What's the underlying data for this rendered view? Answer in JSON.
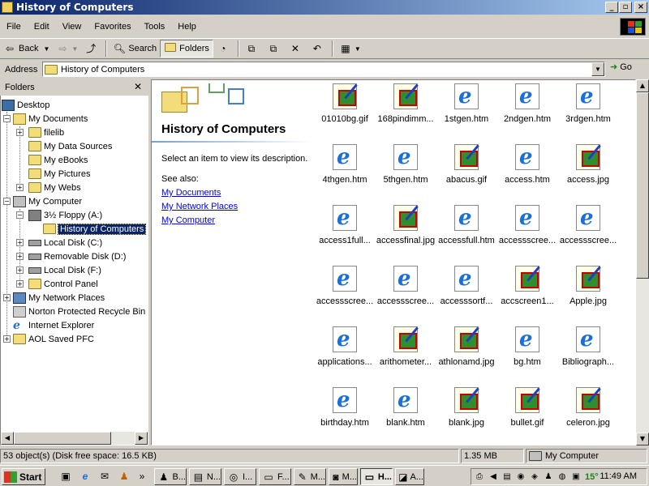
{
  "window": {
    "title": "History of Computers"
  },
  "menu": [
    "File",
    "Edit",
    "View",
    "Favorites",
    "Tools",
    "Help"
  ],
  "toolbar": {
    "back": "Back",
    "search": "Search",
    "folders": "Folders"
  },
  "address": {
    "label": "Address",
    "value": "History of Computers",
    "go": "Go"
  },
  "folders_pane": {
    "title": "Folders",
    "items": [
      {
        "label": "Desktop"
      },
      {
        "label": "My Documents"
      },
      {
        "label": "filelib"
      },
      {
        "label": "My Data Sources"
      },
      {
        "label": "My eBooks"
      },
      {
        "label": "My Pictures"
      },
      {
        "label": "My Webs"
      },
      {
        "label": "My Computer"
      },
      {
        "label": "3½ Floppy (A:)"
      },
      {
        "label": "History of Computers"
      },
      {
        "label": "Local Disk (C:)"
      },
      {
        "label": "Removable Disk (D:)"
      },
      {
        "label": "Local Disk (F:)"
      },
      {
        "label": "Control Panel"
      },
      {
        "label": "My Network Places"
      },
      {
        "label": "Norton Protected Recycle Bin"
      },
      {
        "label": "Internet Explorer"
      },
      {
        "label": "AOL Saved PFC"
      }
    ]
  },
  "info_panel": {
    "title": "History of Computers",
    "prompt": "Select an item to view its description.",
    "see_also": "See also:",
    "links": [
      "My Documents",
      "My Network Places",
      "My Computer"
    ]
  },
  "files": [
    {
      "name": "01010bg.gif",
      "type": "image"
    },
    {
      "name": "168pindimm...",
      "type": "image"
    },
    {
      "name": "1stgen.htm",
      "type": "html"
    },
    {
      "name": "2ndgen.htm",
      "type": "html"
    },
    {
      "name": "3rdgen.htm",
      "type": "html"
    },
    {
      "name": "4thgen.htm",
      "type": "html"
    },
    {
      "name": "5thgen.htm",
      "type": "html"
    },
    {
      "name": "abacus.gif",
      "type": "image"
    },
    {
      "name": "access.htm",
      "type": "html"
    },
    {
      "name": "access.jpg",
      "type": "image"
    },
    {
      "name": "access1full...",
      "type": "html"
    },
    {
      "name": "accessfinal.jpg",
      "type": "image"
    },
    {
      "name": "accessfull.htm",
      "type": "html"
    },
    {
      "name": "accessscree...",
      "type": "html"
    },
    {
      "name": "accessscree...",
      "type": "html"
    },
    {
      "name": "accessscree...",
      "type": "html"
    },
    {
      "name": "accessscree...",
      "type": "html"
    },
    {
      "name": "accesssortf...",
      "type": "html"
    },
    {
      "name": "accscreen1...",
      "type": "image"
    },
    {
      "name": "Apple.jpg",
      "type": "image"
    },
    {
      "name": "applications...",
      "type": "html"
    },
    {
      "name": "arithometer...",
      "type": "image"
    },
    {
      "name": "athlonamd.jpg",
      "type": "image"
    },
    {
      "name": "bg.htm",
      "type": "html"
    },
    {
      "name": "Bibliograph...",
      "type": "html"
    },
    {
      "name": "birthday.htm",
      "type": "html"
    },
    {
      "name": "blank.htm",
      "type": "html"
    },
    {
      "name": "blank.jpg",
      "type": "image"
    },
    {
      "name": "bullet.gif",
      "type": "image"
    },
    {
      "name": "celeron.jpg",
      "type": "image"
    }
  ],
  "status": {
    "objects": "53 object(s) (Disk free space: 16.5 KB)",
    "size": "1.35 MB",
    "zone": "My Computer"
  },
  "taskbar": {
    "start": "Start",
    "tasks": [
      "B...",
      "N...",
      "I...",
      "F...",
      "M...",
      "M...",
      "H...",
      "A..."
    ],
    "clock": "11:49 AM",
    "temp": "15°"
  },
  "colors": {
    "titlebar": "#0a246a",
    "selection": "#0a246a",
    "link": "#0000ee",
    "face": "#d4d0c8"
  }
}
